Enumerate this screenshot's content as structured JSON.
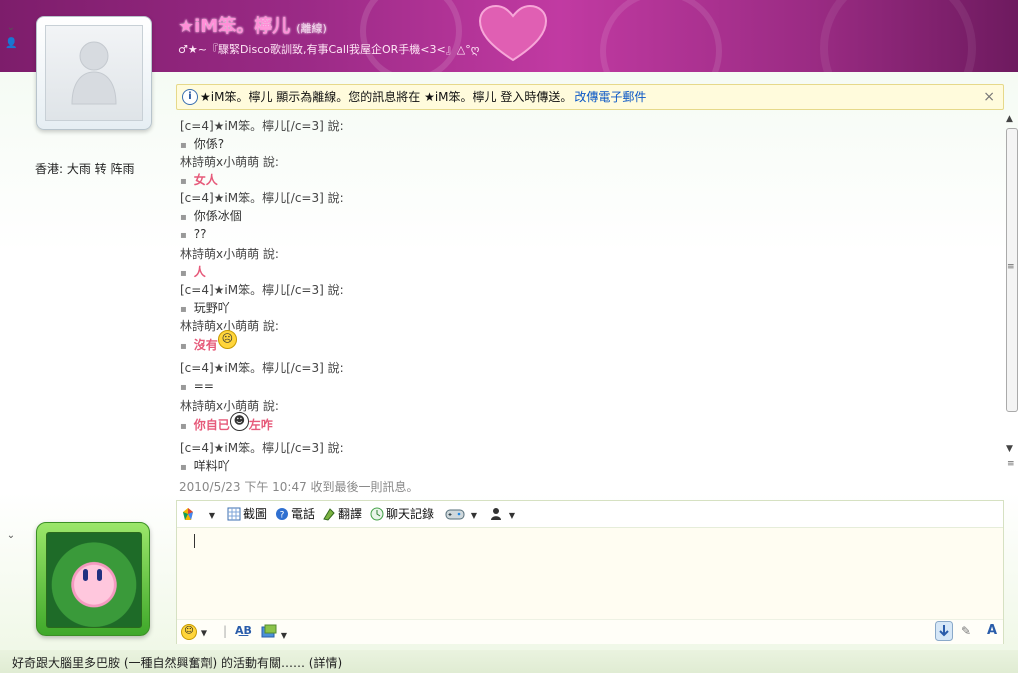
{
  "header": {
    "contact_name": "★iM笨。檸儿",
    "contact_status": "(離線)",
    "personal_message": "♂★~『驟緊Disco歌訓致,有事Call我屋企OR手機<3<』△°ღ"
  },
  "left_panel": {
    "weather": "香港: 大雨 转 阵雨"
  },
  "info_bar": {
    "message": "★iM笨。檸儿 顯示為離線。您的訊息將在 ★iM笨。檸儿 登入時傳送。",
    "link": "改傳電子郵件",
    "close": "×"
  },
  "conversation": [
    {
      "sender": "[c=4]★iM笨。檸儿[/c=3] 說:",
      "messages": [
        {
          "text": "你係?",
          "style": "normal"
        }
      ]
    },
    {
      "sender": "林詩萌x小萌萌 說:",
      "messages": [
        {
          "text": "女人",
          "style": "pink"
        }
      ]
    },
    {
      "sender": "[c=4]★iM笨。檸儿[/c=3] 說:",
      "messages": [
        {
          "text": "你係冰個",
          "style": "normal"
        },
        {
          "text": "??",
          "style": "normal"
        }
      ]
    },
    {
      "sender": "林詩萌x小萌萌 說:",
      "messages": [
        {
          "text": "人",
          "style": "pink"
        }
      ]
    },
    {
      "sender": "[c=4]★iM笨。檸儿[/c=3] 說:",
      "messages": [
        {
          "text": "玩野吖",
          "style": "normal"
        }
      ]
    },
    {
      "sender": "林詩萌x小萌萌 說:",
      "messages": [
        {
          "text": "沒有",
          "style": "pink",
          "emoticon": "sad-face-icon"
        }
      ]
    },
    {
      "sender": "[c=4]★iM笨。檸儿[/c=3] 說:",
      "messages": [
        {
          "text": "==",
          "style": "normal"
        }
      ]
    },
    {
      "sender": "林詩萌x小萌萌 說:",
      "messages": [
        {
          "text": "你自已",
          "text2": "左咋",
          "style": "pink",
          "emoticon": "grin-face-icon"
        }
      ]
    },
    {
      "sender": "[c=4]★iM笨。檸儿[/c=3] 說:",
      "messages": [
        {
          "text": "咩料吖",
          "style": "normal"
        }
      ]
    }
  ],
  "last_message_time": "2010/5/23 下午 10:47 收到最後一則訊息。",
  "toolbar": {
    "screenshot": "截圖",
    "phone": "電話",
    "translate": "翻譯",
    "history": "聊天記錄"
  },
  "status_bar": {
    "text": "好奇跟大腦里多巴胺 (一種自然興奮劑) 的活動有關……  (詳情)"
  },
  "colors": {
    "banner": "#9b2a86",
    "name": "#ff8fd8",
    "pink_message": "#e65a7a",
    "link": "#0b57c6"
  }
}
